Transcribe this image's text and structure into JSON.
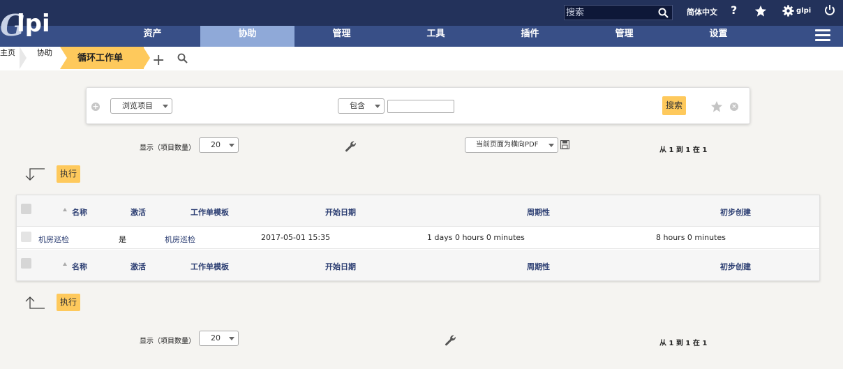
{
  "header": {
    "logo_text": "Glpi",
    "search_placeholder": "搜索",
    "language": "简体中文",
    "help_icon": "question-icon",
    "user_name": "glpi"
  },
  "nav": {
    "items": [
      {
        "label": "资产"
      },
      {
        "label": "协助",
        "active": true
      },
      {
        "label": "管理"
      },
      {
        "label": "工具"
      },
      {
        "label": "插件"
      },
      {
        "label": "管理"
      },
      {
        "label": "设置"
      }
    ]
  },
  "breadcrumb": {
    "home": "主页",
    "helpdesk": "协助",
    "current": "循环工作单"
  },
  "criteria": {
    "field_select": "浏览项目",
    "operator_select": "包含",
    "value": "",
    "search_button": "搜索"
  },
  "display": {
    "count_label": "显示（项目数量）",
    "count_value": "20",
    "export_select": "当前页面为横向PDF",
    "paging": "从 1 到 1 在 1"
  },
  "actions": {
    "execute_label": "执行"
  },
  "table": {
    "headers": [
      "名称",
      "激活",
      "工作单模板",
      "开始日期",
      "周期性",
      "初步创建"
    ],
    "rows": [
      {
        "name": "机房巡检",
        "active": "是",
        "template": "机房巡检",
        "start_date": "2017-05-01 15:35",
        "periodicity": "1 days 0 hours 0 minutes",
        "anticipation": "8 hours 0 minutes"
      }
    ]
  },
  "colors": {
    "topbar": "#23325b",
    "nav": "#384f87",
    "nav_active": "#8fa9d8",
    "accent": "#fec95c",
    "link": "#2d3f73"
  }
}
